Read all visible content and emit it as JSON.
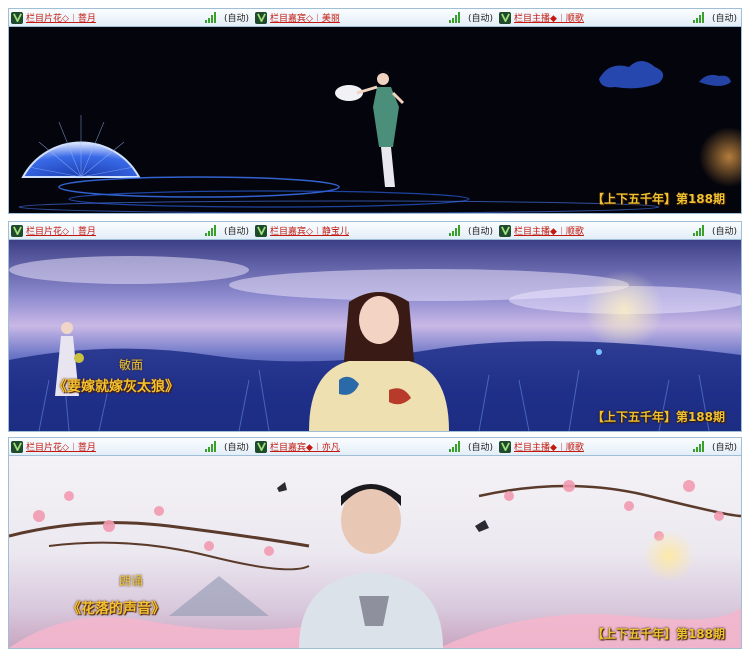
{
  "panels": [
    {
      "tabs": [
        {
          "label": "栏目片花◇︱菩月",
          "status": "(自动)"
        },
        {
          "label": "栏目嘉宾◇︱美丽",
          "status": "(自动)"
        },
        {
          "label": "栏目主播◆︱顺歌",
          "status": "(自动)"
        }
      ],
      "caption": "【上下五千年】第188期"
    },
    {
      "tabs": [
        {
          "label": "栏目片花◇︱菩月",
          "status": "(自动)"
        },
        {
          "label": "栏目嘉宾◇︱静宝儿",
          "status": "(自动)"
        },
        {
          "label": "栏目主播◆︱顺歌",
          "status": "(自动)"
        }
      ],
      "caption": "【上下五千年】第188期",
      "performer": "敏面",
      "program": "《要嫁就嫁灰太狼》"
    },
    {
      "tabs": [
        {
          "label": "栏目片花◇︱菩月",
          "status": "(自动)"
        },
        {
          "label": "栏目嘉宾◆︱亦凡",
          "status": "(自动)"
        },
        {
          "label": "栏目主播◆︱顺歌",
          "status": "(自动)"
        }
      ],
      "caption": "【上下五千年】第188期",
      "performer": "朗诵",
      "program": "《花落的声音》"
    }
  ],
  "colors": {
    "tab_label": "#c2180d",
    "caption": "#f2c230",
    "signal": "#3aa02c"
  },
  "icons": {
    "tab_icon": "v-logo-icon",
    "signal": "signal-bars-icon"
  }
}
